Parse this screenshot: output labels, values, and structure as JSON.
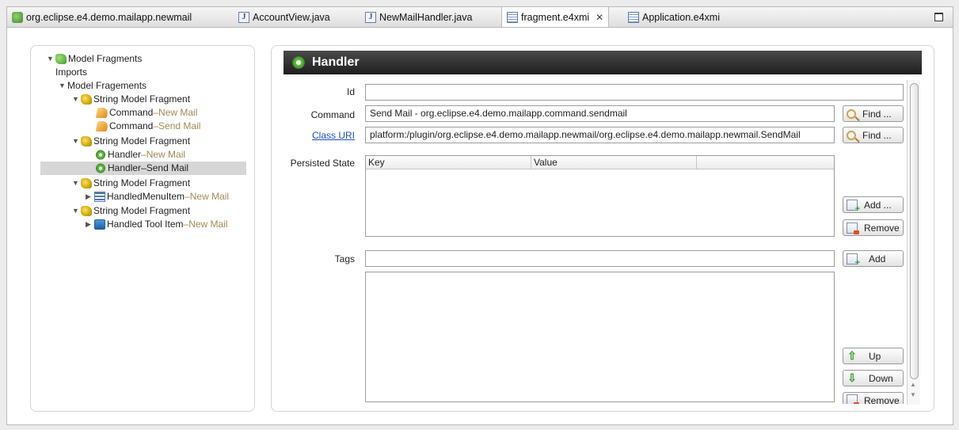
{
  "tabs": [
    {
      "label": "org.eclipse.e4.demo.mailapp.newmail",
      "icon": "plugin-icon"
    },
    {
      "label": "AccountView.java",
      "icon": "java-file-icon"
    },
    {
      "label": "NewMailHandler.java",
      "icon": "java-file-icon"
    },
    {
      "label": "fragment.e4xmi",
      "icon": "xmi-file-icon",
      "active": true,
      "close": "✕"
    },
    {
      "label": "Application.e4xmi",
      "icon": "xmi-file-icon"
    }
  ],
  "tree": {
    "root": "Model Fragments",
    "imports": "Imports",
    "fragements": "Model Fragements",
    "f1": {
      "label": "String Model Fragment",
      "c1": "Command",
      "c1s": "New Mail",
      "c2": "Command",
      "c2s": "Send Mail"
    },
    "f2": {
      "label": "String Model Fragment",
      "h1": "Handler",
      "h1s": "New Mail",
      "h2": "Handler",
      "h2s": "Send Mail"
    },
    "f3": {
      "label": "String Model Fragment",
      "m1": "HandledMenuItem",
      "m1s": "New Mail"
    },
    "f4": {
      "label": "String Model Fragment",
      "t1": "Handled Tool Item",
      "t1s": "New Mail"
    },
    "sep": " – "
  },
  "details": {
    "title": "Handler",
    "id_label": "Id",
    "id_value": "",
    "command_label": "Command",
    "command_value": "Send Mail - org.eclipse.e4.demo.mailapp.command.sendmail",
    "classuri_label": "Class URI",
    "classuri_value": "platform:/plugin/org.eclipse.e4.demo.mailapp.newmail/org.eclipse.e4.demo.mailapp.newmail.SendMail",
    "find": "Find ...",
    "persisted_label": "Persisted State",
    "col_key": "Key",
    "col_value": "Value",
    "add_dots": "Add ...",
    "remove": "Remove",
    "tags_label": "Tags",
    "tags_value": "",
    "add": "Add",
    "up": "Up",
    "down": "Down"
  }
}
